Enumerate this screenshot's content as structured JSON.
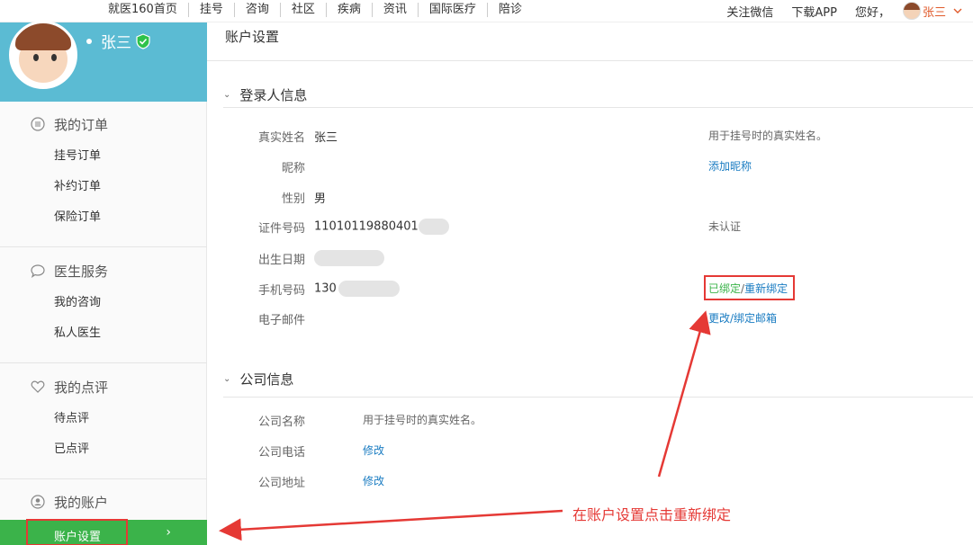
{
  "topnav": {
    "links": [
      "就医160首页",
      "挂号",
      "咨询",
      "社区",
      "疾病",
      "资讯",
      "国际医疗",
      "陪诊"
    ],
    "follow_wechat": "关注微信",
    "download_app": "下载APP",
    "greeting": "您好，",
    "username": "张三",
    "dropdown_icon": "chevron-down-icon"
  },
  "sidebar": {
    "profile_name": "张三",
    "groups": [
      {
        "title": "我的订单",
        "icon": "list-icon",
        "items": [
          "挂号订单",
          "补约订单",
          "保险订单"
        ]
      },
      {
        "title": "医生服务",
        "icon": "chat-bubble-icon",
        "items": [
          "我的咨询",
          "私人医生"
        ]
      },
      {
        "title": "我的点评",
        "icon": "heart-icon",
        "items": [
          "待点评",
          "已点评"
        ]
      },
      {
        "title": "我的账户",
        "icon": "user-icon",
        "items": []
      }
    ],
    "active_item": "账户设置",
    "active_chevron": "›"
  },
  "main": {
    "page_title": "账户设置",
    "login_section": {
      "title": "登录人信息",
      "rows": [
        {
          "label": "真实姓名",
          "value": "张三",
          "note": "用于挂号时的真实姓名。"
        },
        {
          "label": "昵称",
          "value": "",
          "note": "添加昵称"
        },
        {
          "label": "性别",
          "value": "男",
          "note": ""
        },
        {
          "label": "证件号码",
          "value": "11010119880401",
          "note": "未认证"
        },
        {
          "label": "出生日期",
          "value": "",
          "note": ""
        },
        {
          "label": "手机号码",
          "value": "130",
          "note_green": "已绑定",
          "note_sep": "/",
          "note_link": "重新绑定"
        },
        {
          "label": "电子邮件",
          "value": "",
          "note": "更改/绑定邮箱"
        }
      ]
    },
    "company_section": {
      "title": "公司信息",
      "rows": [
        {
          "label": "公司名称",
          "value": "用于挂号时的真实姓名。"
        },
        {
          "label": "公司电话",
          "value": "修改"
        },
        {
          "label": "公司地址",
          "value": "修改"
        }
      ]
    }
  },
  "annotation": "在账户设置点击重新绑定",
  "colors": {
    "brand_blue": "#5bbbd3",
    "active_green": "#3bb34a",
    "link_blue": "#1a7cc2",
    "highlight_red": "#e53935"
  }
}
